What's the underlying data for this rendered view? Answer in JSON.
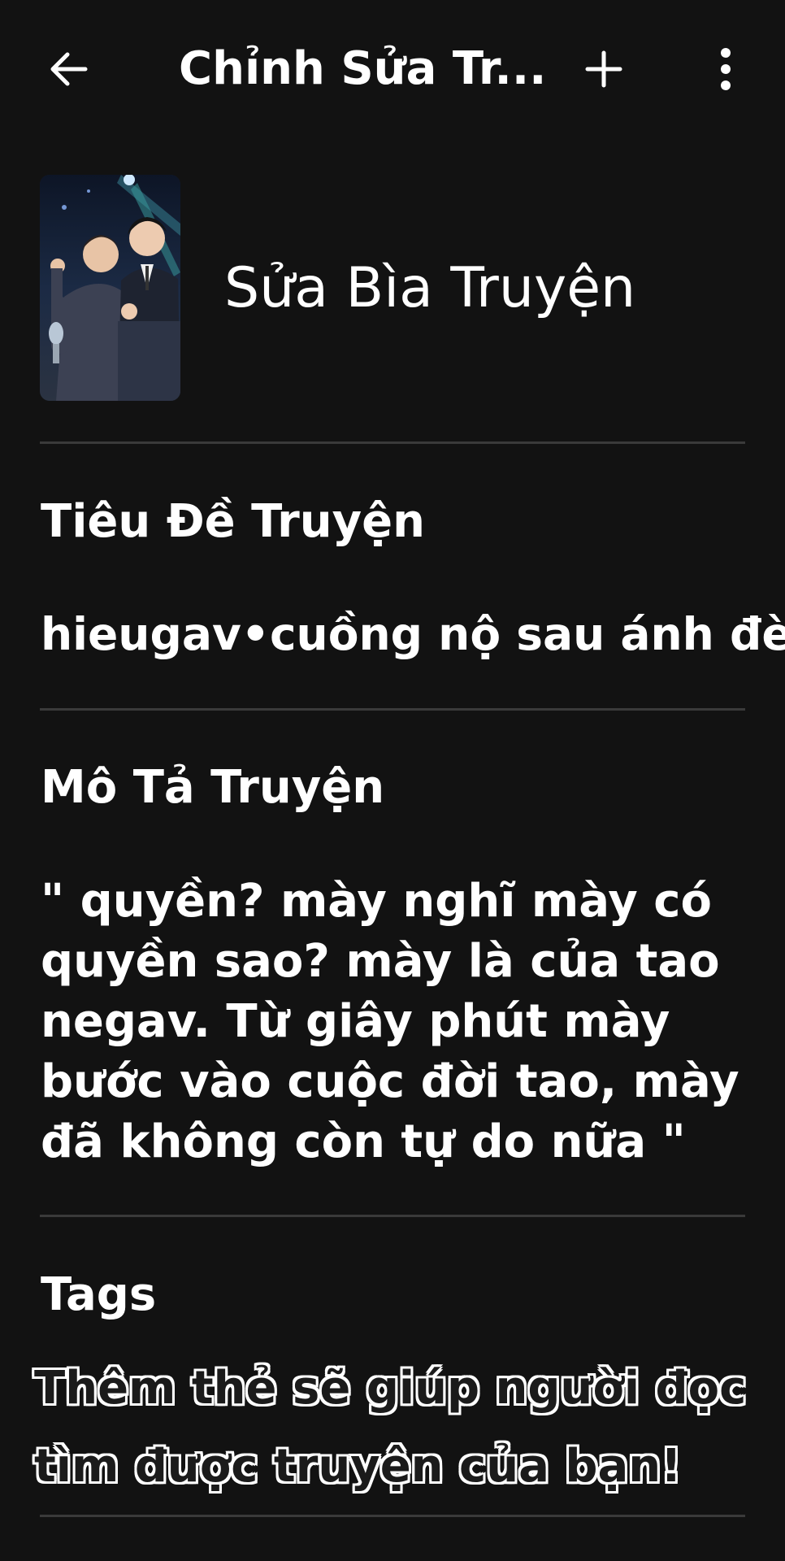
{
  "appbar": {
    "title": "Chỉnh Sửa Tr...",
    "back_icon": "arrow-left-icon",
    "add_icon": "plus-icon",
    "more_icon": "more-vertical-icon"
  },
  "cover": {
    "label": "Sửa Bìa Truyện"
  },
  "story_title": {
    "heading": "Tiêu Đề Truyện",
    "value": "hieugav•cuồng nộ sau ánh đèn"
  },
  "story_description": {
    "heading": "Mô Tả Truyện",
    "value": "\" quyền? mày nghĩ mày có quyền sao? mày là của tao negav. Từ giây phút mày bước vào cuộc đời tao, mày đã không còn tự do nữa \""
  },
  "tags": {
    "heading": "Tags",
    "hint": "Thêm thẻ sẽ giúp người đọc tìm được truyện của bạn!"
  },
  "colors": {
    "background": "#121212",
    "divider": "#3a3a3a",
    "text": "#ffffff"
  }
}
